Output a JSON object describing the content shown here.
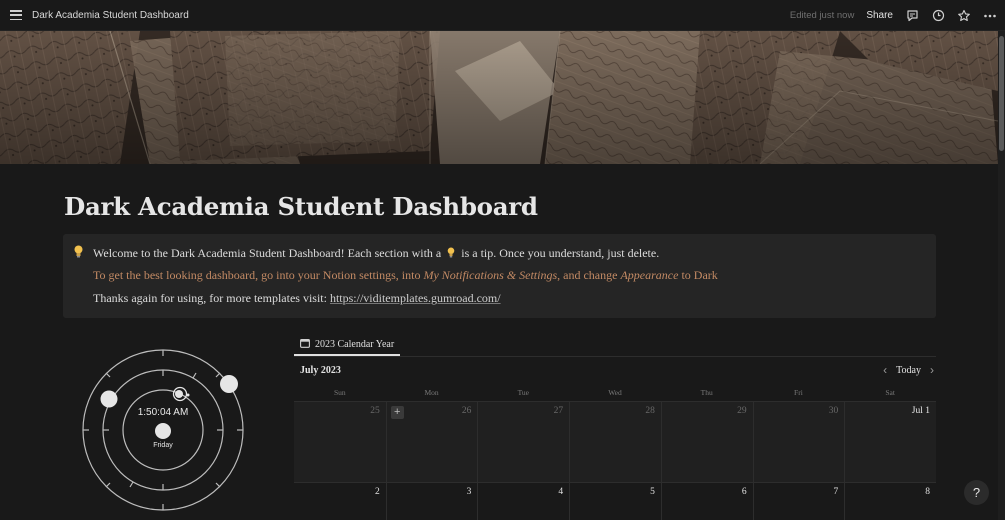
{
  "topbar": {
    "page_title": "Dark Academia Student Dashboard",
    "edited_status": "Edited just now",
    "share_label": "Share",
    "icons": [
      "menu-icon",
      "comment-icon",
      "history-icon",
      "star-icon",
      "more-icon"
    ]
  },
  "page": {
    "title": "Dark Academia Student Dashboard"
  },
  "callout": {
    "icon": "lightbulb-icon",
    "line1_a": "Welcome to the Dark Academia Student Dashboard! Each section with a",
    "line1_b": "is a tip. Once you understand, just delete.",
    "line2_a": "To get the best looking dashboard, go into your Notion settings, into",
    "line2_em1": "My Notifications & Settings",
    "line2_b": ", and change",
    "line2_em2": "Appearance",
    "line2_c": "to Dark",
    "line3_a": "Thanks again for using, for more templates visit:",
    "line3_link": "https://viditemplates.gumroad.com/"
  },
  "clock": {
    "time": "1:50:04 AM",
    "day": "Friday"
  },
  "calendar": {
    "tab_label": "2023 Calendar Year",
    "month": "July 2023",
    "today_label": "Today",
    "weekdays": [
      "Sun",
      "Mon",
      "Tue",
      "Wed",
      "Thu",
      "Fri",
      "Sat"
    ],
    "weeks": [
      [
        "25",
        "26",
        "27",
        "28",
        "29",
        "30",
        "Jul 1"
      ],
      [
        "2",
        "3",
        "4",
        "5",
        "6",
        "7",
        "8"
      ]
    ]
  },
  "help": {
    "label": "?"
  },
  "colors": {
    "background": "#191919",
    "callout_bg": "#252525",
    "accent_brown": "#c38a64"
  }
}
